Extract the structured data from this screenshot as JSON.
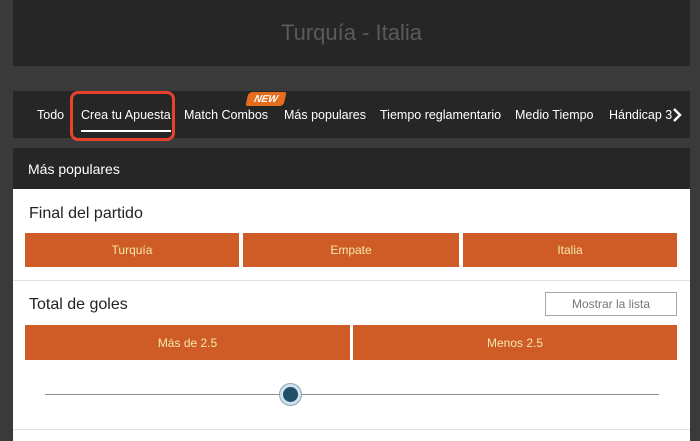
{
  "match_title": "Turquía - Italia",
  "tabs": [
    {
      "label": "Todo"
    },
    {
      "label": "Crea tu Apuesta",
      "active": true
    },
    {
      "label": "Match Combos",
      "badge": "NEW"
    },
    {
      "label": "Más populares"
    },
    {
      "label": "Tiempo reglamentario"
    },
    {
      "label": "Medio Tiempo"
    },
    {
      "label": "Hándicap 3"
    }
  ],
  "section_title": "Más populares",
  "markets": [
    {
      "title": "Final del partido",
      "options": [
        "Turquía",
        "Empate",
        "Italia"
      ]
    },
    {
      "title": "Total de goles",
      "list_button": "Mostrar la lista",
      "options": [
        "Más de 2.5",
        "Menos 2.5"
      ],
      "slider_level": 0.38
    }
  ],
  "colors": {
    "accent": "#cf5b26",
    "button_text": "#f5e9a8",
    "highlight": "#e8412c",
    "badge": "#e46d1e",
    "dark": "#262626"
  },
  "icons": {
    "next_tabs": "chevron-right-icon"
  }
}
